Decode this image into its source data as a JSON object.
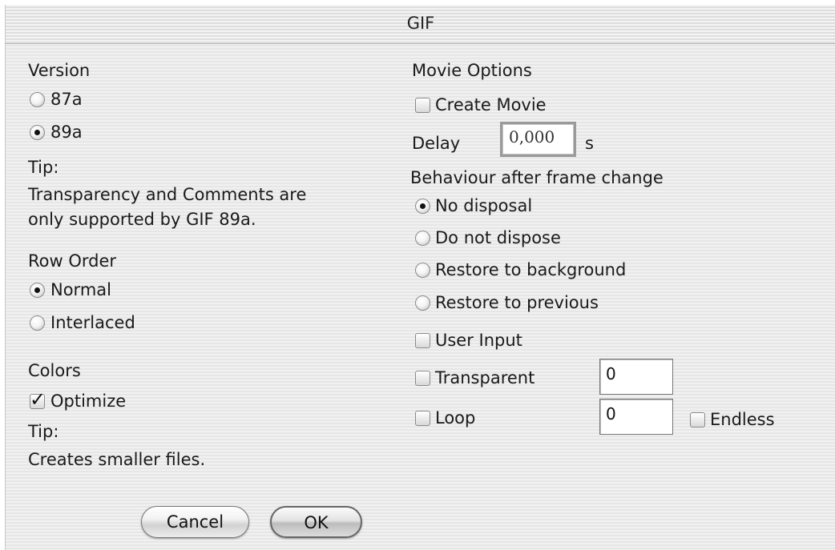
{
  "window": {
    "title": "GIF"
  },
  "version": {
    "label": "Version",
    "options": [
      "87a",
      "89a"
    ],
    "selected": "89a",
    "tip_label": "Tip:",
    "tip_line1": "Transparency and Comments are",
    "tip_line2": "only supported by GIF 89a."
  },
  "row_order": {
    "label": "Row Order",
    "options": [
      "Normal",
      "Interlaced"
    ],
    "selected": "Normal"
  },
  "colors": {
    "label": "Colors",
    "optimize_label": "Optimize",
    "optimize_checked": true,
    "checkmark": "✓",
    "tip_label": "Tip:",
    "tip_text": "Creates smaller files."
  },
  "movie": {
    "label": "Movie Options",
    "create_movie_label": "Create Movie",
    "create_movie_checked": false,
    "delay_label": "Delay",
    "delay_value": "0,000",
    "delay_unit": "s",
    "behaviour_label": "Behaviour after frame change",
    "disposal_options": [
      "No disposal",
      "Do not dispose",
      "Restore to background",
      "Restore to previous"
    ],
    "disposal_selected": "No disposal",
    "user_input_label": "User Input",
    "transparent_label": "Transparent",
    "transparent_value": "0",
    "loop_label": "Loop",
    "loop_value": "0",
    "endless_label": "Endless"
  },
  "buttons": {
    "cancel": "Cancel",
    "ok": "OK"
  }
}
